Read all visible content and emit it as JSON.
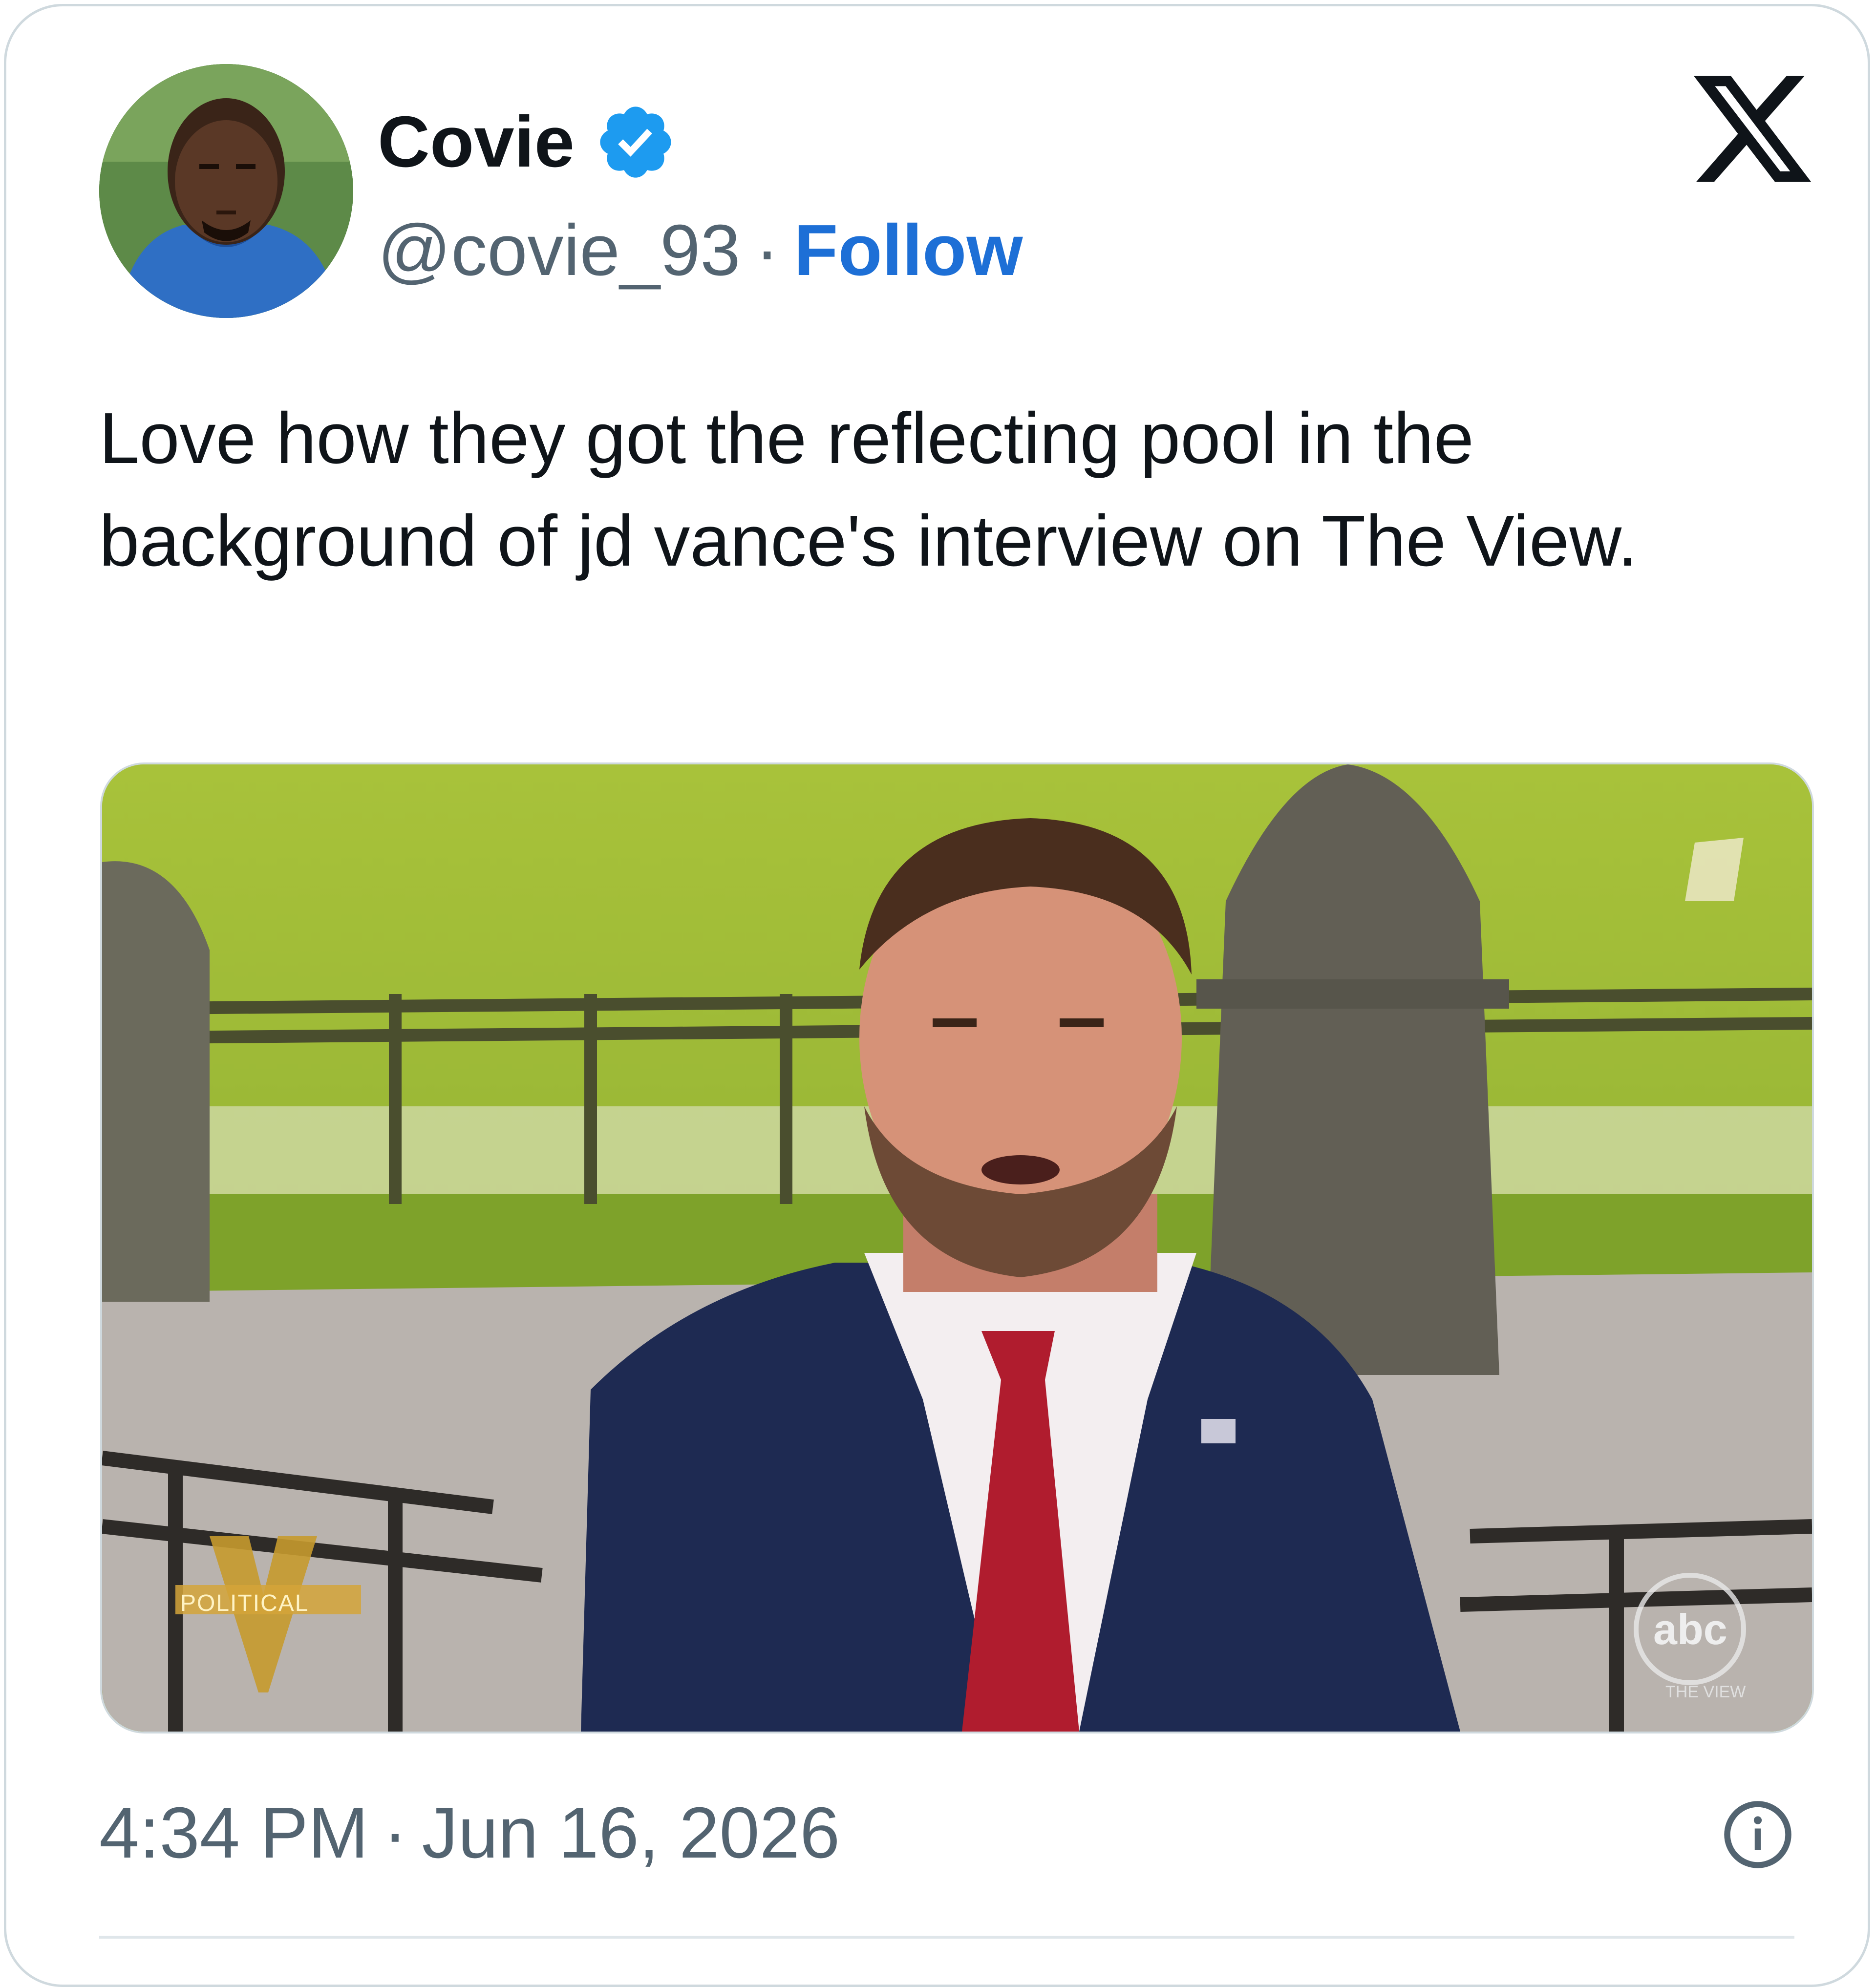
{
  "tweet": {
    "display_name": "Covie",
    "verified_icon": "verified-badge-icon",
    "handle": "@covie_93",
    "separator": "·",
    "follow_label": "Follow",
    "platform_icon": "x-logo-icon",
    "text": "Love how they got the reflecting pool in the background of jd vance's interview on The View.",
    "time": "4:34 PM",
    "date_separator": "·",
    "date": "Jun 16, 2026",
    "info_icon": "info-icon"
  },
  "media": {
    "overlay_labels": {
      "show_bug": "POLITICAL",
      "network": "abc",
      "network_sub": "THE VIEW"
    }
  },
  "colors": {
    "accent": "#1d6fd6",
    "verified": "#1d9bf0",
    "text": "#0f1419",
    "secondary": "#536471",
    "border": "#cfd9de"
  }
}
